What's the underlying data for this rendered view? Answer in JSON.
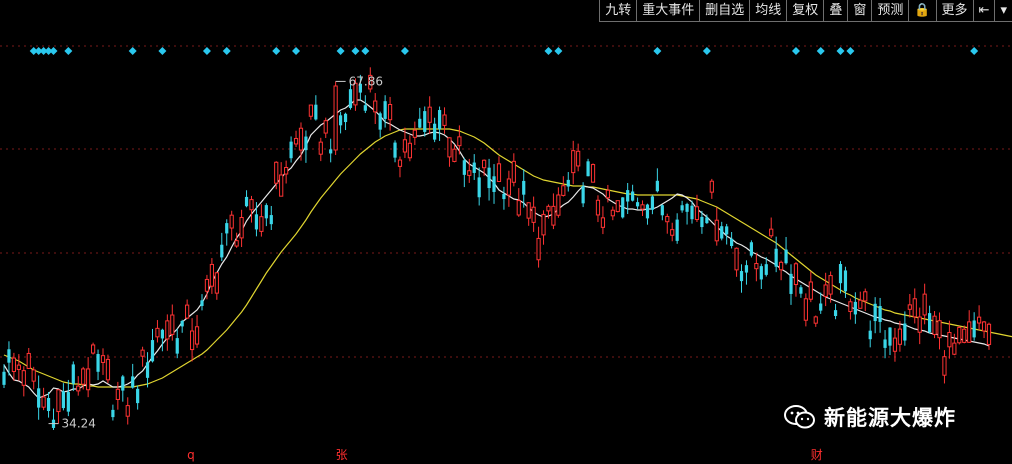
{
  "toolbar": {
    "items": [
      "九转",
      "重大事件",
      "删自选",
      "均线",
      "复权",
      "叠",
      "窗",
      "预测",
      "🔒",
      "更多",
      "⇤",
      "▾"
    ]
  },
  "colors": {
    "background": "#000000",
    "up": "#ff3333",
    "down": "#3ad6e8",
    "ma_short": "#e8e8e8",
    "ma_long": "#e0d530",
    "grid": "#7a1a1a",
    "diamond": "#2ac8ee"
  },
  "watermark": {
    "text": "新能源大爆炸",
    "icon": "wechat-icon"
  },
  "bottom_markers": [
    {
      "label": "q",
      "index": 38
    },
    {
      "label": "张",
      "index": 68
    },
    {
      "label": "财",
      "index": 164
    }
  ],
  "chart_data": {
    "type": "candlestick",
    "ylim": [
      31,
      72
    ],
    "grid": true,
    "annotations": [
      {
        "label": "67.86",
        "value": 67.86,
        "kind": "high"
      },
      {
        "label": "34.24",
        "value": 34.24,
        "kind": "low"
      }
    ],
    "event_diamond_indices": [
      6,
      7,
      8,
      9,
      10,
      13,
      26,
      32,
      41,
      45,
      55,
      59,
      68,
      71,
      73,
      81,
      110,
      112,
      132,
      142,
      160,
      165,
      169,
      171,
      196
    ],
    "ma_short": [
      39.5,
      38.7,
      38.0,
      37.9,
      37.6,
      37.3,
      36.7,
      36.2,
      36.4,
      36.6,
      37.2,
      37.1,
      36.8,
      36.9,
      37.1,
      37.1,
      37.4,
      37.6,
      37.5,
      37.6,
      37.9,
      37.6,
      37.3,
      37.3,
      37.4,
      37.6,
      37.9,
      38.5,
      38.9,
      39.6,
      40.3,
      40.9,
      41.6,
      42.2,
      42.6,
      43.1,
      43.8,
      44.2,
      44.6,
      45.0,
      45.7,
      46.6,
      47.8,
      48.7,
      49.6,
      50.3,
      51.3,
      52.2,
      52.9,
      53.9,
      54.6,
      55.2,
      55.8,
      56.4,
      57.0,
      57.6,
      58.2,
      58.8,
      59.2,
      59.9,
      60.5,
      61.4,
      62.5,
      63.0,
      63.5,
      63.8,
      64.2,
      64.6,
      65.0,
      65.2,
      65.6,
      66.0,
      66.0,
      65.7,
      65.3,
      64.9,
      64.4,
      63.8,
      63.6,
      63.3,
      63.0,
      62.8,
      62.6,
      62.4,
      62.4,
      62.5,
      62.7,
      62.8,
      62.7,
      62.5,
      62.1,
      61.6,
      60.9,
      60.1,
      59.6,
      59.3,
      59.0,
      58.7,
      58.2,
      57.7,
      57.0,
      56.7,
      56.4,
      56.1,
      56.0,
      55.7,
      55.2,
      54.8,
      54.5,
      54.3,
      54.4,
      54.6,
      55.1,
      55.5,
      55.8,
      56.3,
      56.9,
      57.4,
      57.3,
      57.2,
      56.9,
      56.6,
      56.1,
      55.8,
      55.5,
      55.3,
      55.1,
      55.1,
      55.0,
      55.0,
      55.1,
      55.1,
      55.3,
      55.6,
      55.9,
      56.2,
      56.6,
      56.5,
      56.2,
      55.8,
      55.1,
      54.7,
      54.3,
      53.8,
      53.3,
      52.9,
      52.4,
      52.1,
      51.7,
      51.5,
      51.2,
      50.8,
      50.6,
      50.3,
      50.1,
      49.8,
      49.5,
      49.1,
      48.8,
      48.4,
      48.1,
      47.8,
      47.5,
      47.2,
      46.9,
      46.6,
      46.3,
      46.1,
      45.9,
      45.7,
      45.5,
      45.3,
      45.1,
      44.9,
      44.7,
      44.5,
      44.3,
      44.2,
      44.0,
      43.9,
      43.7,
      43.6,
      43.5,
      43.3,
      43.1,
      43.0,
      42.9,
      42.7,
      42.6,
      42.5,
      42.4,
      42.3,
      42.2,
      42.1,
      42.0,
      41.9,
      41.8,
      41.7,
      41.6,
      41.4
    ],
    "ma_long": [
      40.5,
      40.3,
      40.1,
      39.9,
      39.6,
      39.3,
      39.0,
      38.8,
      38.6,
      38.4,
      38.2,
      38.0,
      37.8,
      37.7,
      37.6,
      37.6,
      37.5,
      37.4,
      37.4,
      37.3,
      37.3,
      37.3,
      37.3,
      37.3,
      37.3,
      37.3,
      37.3,
      37.4,
      37.5,
      37.6,
      37.8,
      38.0,
      38.2,
      38.5,
      38.8,
      39.1,
      39.4,
      39.7,
      40.0,
      40.3,
      40.6,
      41.0,
      41.5,
      42.0,
      42.5,
      43.0,
      43.6,
      44.2,
      44.8,
      45.5,
      46.3,
      47.1,
      47.9,
      48.7,
      49.4,
      50.1,
      50.8,
      51.4,
      52.0,
      52.6,
      53.3,
      54.0,
      54.8,
      55.5,
      56.2,
      56.8,
      57.4,
      58.0,
      58.6,
      59.1,
      59.6,
      60.1,
      60.6,
      61.0,
      61.4,
      61.8,
      62.1,
      62.4,
      62.6,
      62.8,
      63.0,
      63.1,
      63.1,
      63.1,
      63.1,
      63.1,
      63.1,
      63.1,
      63.1,
      63.1,
      63.1,
      63.0,
      62.9,
      62.7,
      62.5,
      62.3,
      62.0,
      61.7,
      61.3,
      60.9,
      60.5,
      60.2,
      59.9,
      59.6,
      59.3,
      59.0,
      58.7,
      58.4,
      58.2,
      58.0,
      57.9,
      57.8,
      57.7,
      57.6,
      57.5,
      57.4,
      57.4,
      57.4,
      57.3,
      57.3,
      57.2,
      57.1,
      57.0,
      56.9,
      56.8,
      56.7,
      56.6,
      56.6,
      56.5,
      56.5,
      56.5,
      56.5,
      56.5,
      56.5,
      56.5,
      56.5,
      56.5,
      56.4,
      56.3,
      56.2,
      56.1,
      55.9,
      55.7,
      55.5,
      55.3,
      55.0,
      54.7,
      54.4,
      54.1,
      53.8,
      53.5,
      53.2,
      52.9,
      52.6,
      52.3,
      52.0,
      51.7,
      51.3,
      50.9,
      50.5,
      50.1,
      49.7,
      49.3,
      48.9,
      48.5,
      48.2,
      47.9,
      47.6,
      47.3,
      47.0,
      46.7,
      46.5,
      46.2,
      46.0,
      45.8,
      45.6,
      45.4,
      45.2,
      45.0,
      44.9,
      44.7,
      44.6,
      44.5,
      44.4,
      44.3,
      44.2,
      44.1,
      44.0,
      43.9,
      43.8,
      43.7,
      43.6,
      43.5,
      43.4,
      43.3,
      43.2,
      43.1,
      43.0,
      42.9,
      42.8,
      42.7,
      42.6,
      42.5,
      42.4,
      42.3
    ]
  }
}
